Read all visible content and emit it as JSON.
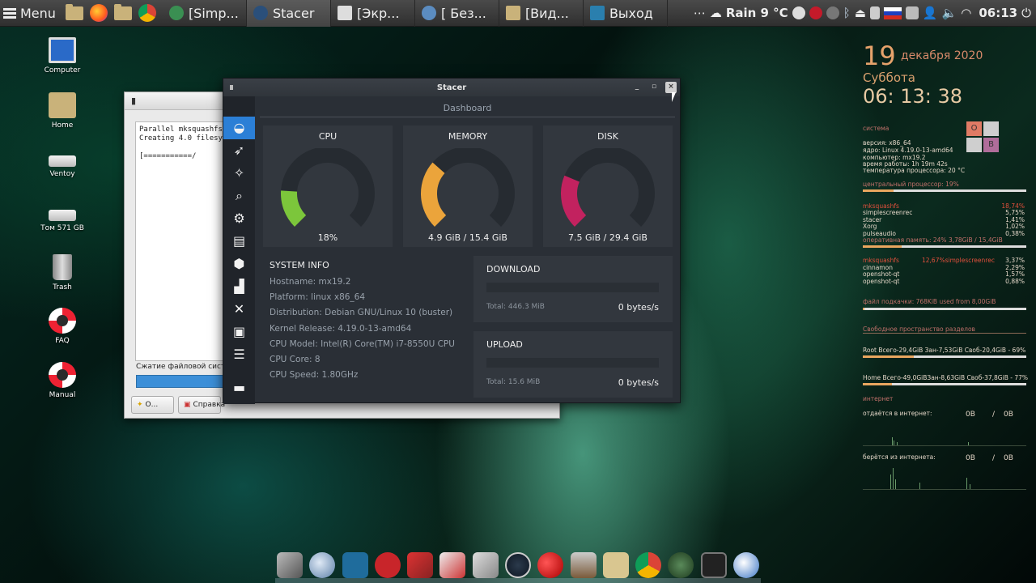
{
  "panel": {
    "menu_label": "Menu",
    "tasks": [
      {
        "label": "[Simp...",
        "active": false,
        "color": "#3a8f52"
      },
      {
        "label": "Stacer",
        "active": true,
        "color": "#2a4f7a"
      },
      {
        "label": "[Экр...",
        "active": false,
        "color": "#dddddd"
      },
      {
        "label": "[ Без...",
        "active": false,
        "color": "#5b8cc0"
      },
      {
        "label": "[Вид...",
        "active": false,
        "color": "#c9b27a"
      },
      {
        "label": "Выход",
        "active": false,
        "color": "#2a7fae"
      }
    ],
    "weather": "Rain 9 °C",
    "clock": "06:13"
  },
  "desktop_icons": [
    {
      "label": "Computer"
    },
    {
      "label": "Home"
    },
    {
      "label": "Ventoy"
    },
    {
      "label": "Том 571 GB"
    },
    {
      "label": "Trash"
    },
    {
      "label": "FAQ"
    },
    {
      "label": "Manual"
    }
  ],
  "back_window": {
    "terminal": "Parallel mksquashfs: U\nCreating 4.0 filesyste\n\n[===========/",
    "status_label": "Сжатие файловой систем",
    "ok_label": "О...",
    "help_label": "Справка"
  },
  "stacer": {
    "title": "Stacer",
    "page_title": "Dashboard",
    "gauges": [
      {
        "title": "CPU",
        "value": "18%",
        "percent": 18,
        "color": "#7cc63b"
      },
      {
        "title": "MEMORY",
        "value": "4.9 GiB / 15.4 GiB",
        "percent": 32,
        "color": "#eba43b"
      },
      {
        "title": "DISK",
        "value": "7.5 GiB / 29.4 GiB",
        "percent": 25,
        "color": "#c2225f"
      }
    ],
    "sysinfo": {
      "heading": "SYSTEM INFO",
      "rows": [
        "Hostname: mx19.2",
        "Platform: linux x86_64",
        "Distribution: Debian GNU/Linux 10 (buster)",
        "Kernel Release: 4.19.0-13-amd64",
        "CPU Model: Intel(R) Core(TM) i7-8550U CPU",
        "CPU Core: 8",
        "CPU Speed: 1.80GHz"
      ]
    },
    "download": {
      "title": "DOWNLOAD",
      "total": "Total: 446.3 MiB",
      "speed": "0 bytes/s"
    },
    "upload": {
      "title": "UPLOAD",
      "total": "Total: 15.6 MiB",
      "speed": "0 bytes/s"
    }
  },
  "conky": {
    "day": "19",
    "month": "декабря 2020",
    "weekday": "Суббота",
    "time": "06: 13: 38",
    "system_header": "система",
    "system_lines": [
      "версия:  x86_64",
      "ядро: Linux 4.19.0-13-amd64",
      "компьютер: mx19.2",
      "время работы: 1h 19m 42s",
      "температура процессора: 20 °C"
    ],
    "cpu_header": "центральный процессор: 19%",
    "cpu_percent": 19,
    "cpu_procs": [
      {
        "name": "mksquashfs",
        "val": "18,74%"
      },
      {
        "name": "simplescreenrec",
        "val": "5,75%"
      },
      {
        "name": "stacer",
        "val": "1,41%"
      },
      {
        "name": "Xorg",
        "val": "1,02%"
      },
      {
        "name": "pulseaudio",
        "val": "0,38%"
      }
    ],
    "ram_header": "оперативная память: 24% 3,78GiB / 15,4GiB",
    "ram_percent": 24,
    "ram_procs": [
      {
        "name": "mksquashfs",
        "mid": "12,67%simplescreenrec",
        "val": "3,37%"
      },
      {
        "name": "cinnamon",
        "mid": "",
        "val": "2,29%"
      },
      {
        "name": "openshot-qt",
        "mid": "",
        "val": "1,57%"
      },
      {
        "name": "openshot-qt",
        "mid": "",
        "val": "0,88%"
      }
    ],
    "swap_header": "файл подкачки: 768KiB used from 8,00GiB",
    "swap_percent": 1,
    "parts_header": "Свободное пространство разделов",
    "root_line": "Root Всего-29,4GiB Зан-7,53GiB Своб-20,4GiB - 69%",
    "root_percent": 31,
    "home_line": "Home Всего-49,0GiBЗан-8,63GiB Своб-37,8GiB - 77%",
    "home_percent": 18,
    "net_header": "интернет",
    "up_label": "отдаётся в интернет:",
    "up_a": "0B",
    "up_sep": "/",
    "up_b": "0B",
    "down_label": "берётся из интернета:",
    "down_a": "0B",
    "down_sep": "/",
    "down_b": "0B",
    "tile_o": "O",
    "tile_b": "B"
  }
}
